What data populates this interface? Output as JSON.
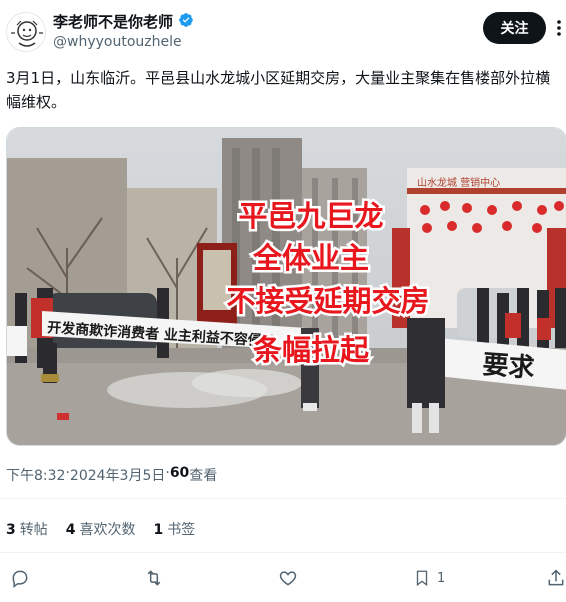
{
  "author": {
    "display_name": "李老师不是你老师",
    "handle": "@whyyoutouzhele",
    "verified_icon": "verified-badge-icon"
  },
  "follow_label": "关注",
  "tweet": {
    "text": "3月1日，山东临沂。平邑县山水龙城小区延期交房，大量业主聚集在售楼部外拉横幅维权。"
  },
  "media": {
    "overlay_lines": [
      "平邑九巨龙",
      "全体业主",
      "不接受延期交房",
      "条幅拉起"
    ],
    "building_sign": "山水龙城 营销中心",
    "banner_left": "开发商欺诈消费者 业主利益不容侵犯",
    "banner_right": "要求",
    "colors": {
      "overlay_text": "#e8171d",
      "overlay_stroke": "#ffffff"
    }
  },
  "meta": {
    "time": "下午8:32",
    "separator1": " · ",
    "date": "2024年3月5日",
    "separator2": " · ",
    "views_count": "60",
    "views_label": " 查看"
  },
  "stats": {
    "retweets_count": "3",
    "retweets_label": "转帖",
    "likes_count": "4",
    "likes_label": "喜欢次数",
    "bookmarks_count": "1",
    "bookmarks_label": "书签"
  },
  "actions": {
    "bookmark_count": "1"
  }
}
